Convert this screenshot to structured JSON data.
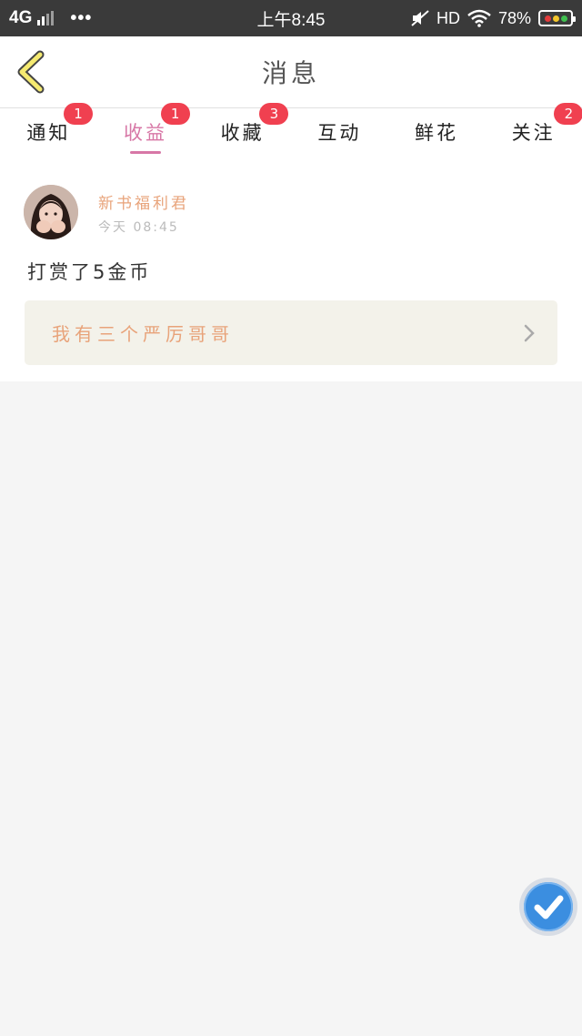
{
  "status_bar": {
    "network": "4G",
    "dots": "•••",
    "time": "上午8:45",
    "hd": "HD",
    "battery": "78%"
  },
  "header": {
    "title": "消息"
  },
  "tabs": [
    {
      "label": "通知",
      "badge": "1"
    },
    {
      "label": "收益",
      "badge": "1",
      "active": true
    },
    {
      "label": "收藏",
      "badge": "3"
    },
    {
      "label": "互动",
      "badge": ""
    },
    {
      "label": "鲜花",
      "badge": ""
    },
    {
      "label": "关注",
      "badge": "2"
    }
  ],
  "message": {
    "sender": "新书福利君",
    "time": "今天 08:45",
    "text": "打赏了5金币",
    "book_title": "我有三个严厉哥哥"
  },
  "colors": {
    "accent": "#d777a6",
    "badge": "#f04050",
    "name": "#e8a37a"
  }
}
